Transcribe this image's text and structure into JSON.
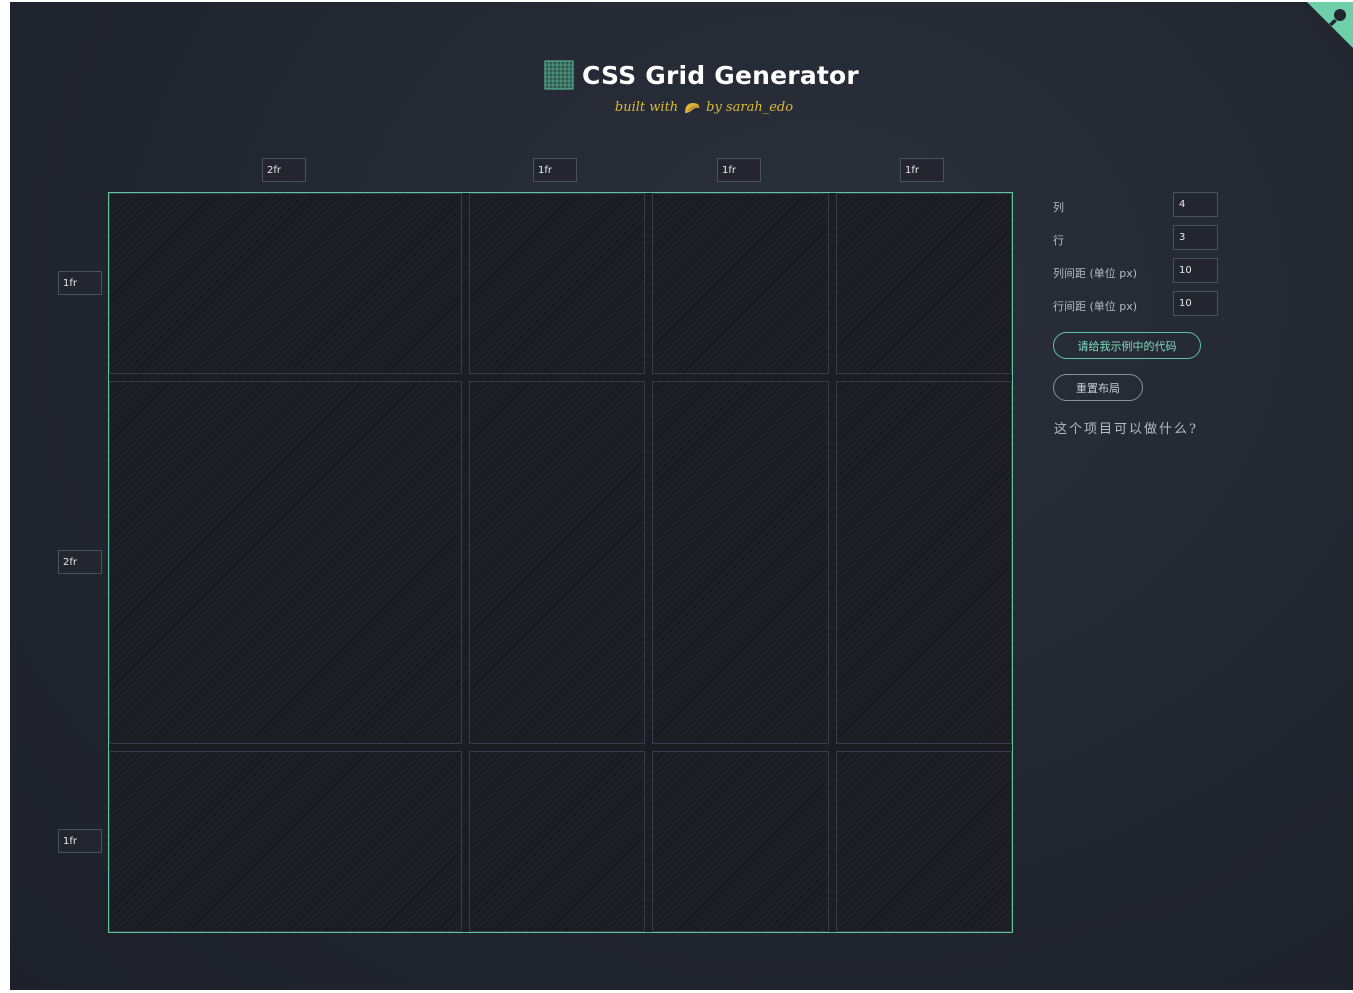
{
  "header": {
    "title": "CSS Grid Generator",
    "subtitle_prefix": "built with",
    "subtitle_suffix": "by sarah_edo"
  },
  "grid": {
    "columns": [
      "2fr",
      "1fr",
      "1fr",
      "1fr"
    ],
    "rows": [
      "1fr",
      "2fr",
      "1fr"
    ]
  },
  "controls": {
    "columns_label": "列",
    "columns_value": "4",
    "rows_label": "行",
    "rows_value": "3",
    "column_gap_label": "列间距 (单位 px)",
    "column_gap_value": "10",
    "row_gap_label": "行间距 (单位 px)",
    "row_gap_value": "10"
  },
  "buttons": {
    "show_code": "请给我示例中的代码",
    "reset": "重置布局"
  },
  "about_link": "这个项目可以做什么?",
  "colors": {
    "accent": "#5ec3a0",
    "subtitle": "#d8b93a",
    "background": "#22262f"
  }
}
